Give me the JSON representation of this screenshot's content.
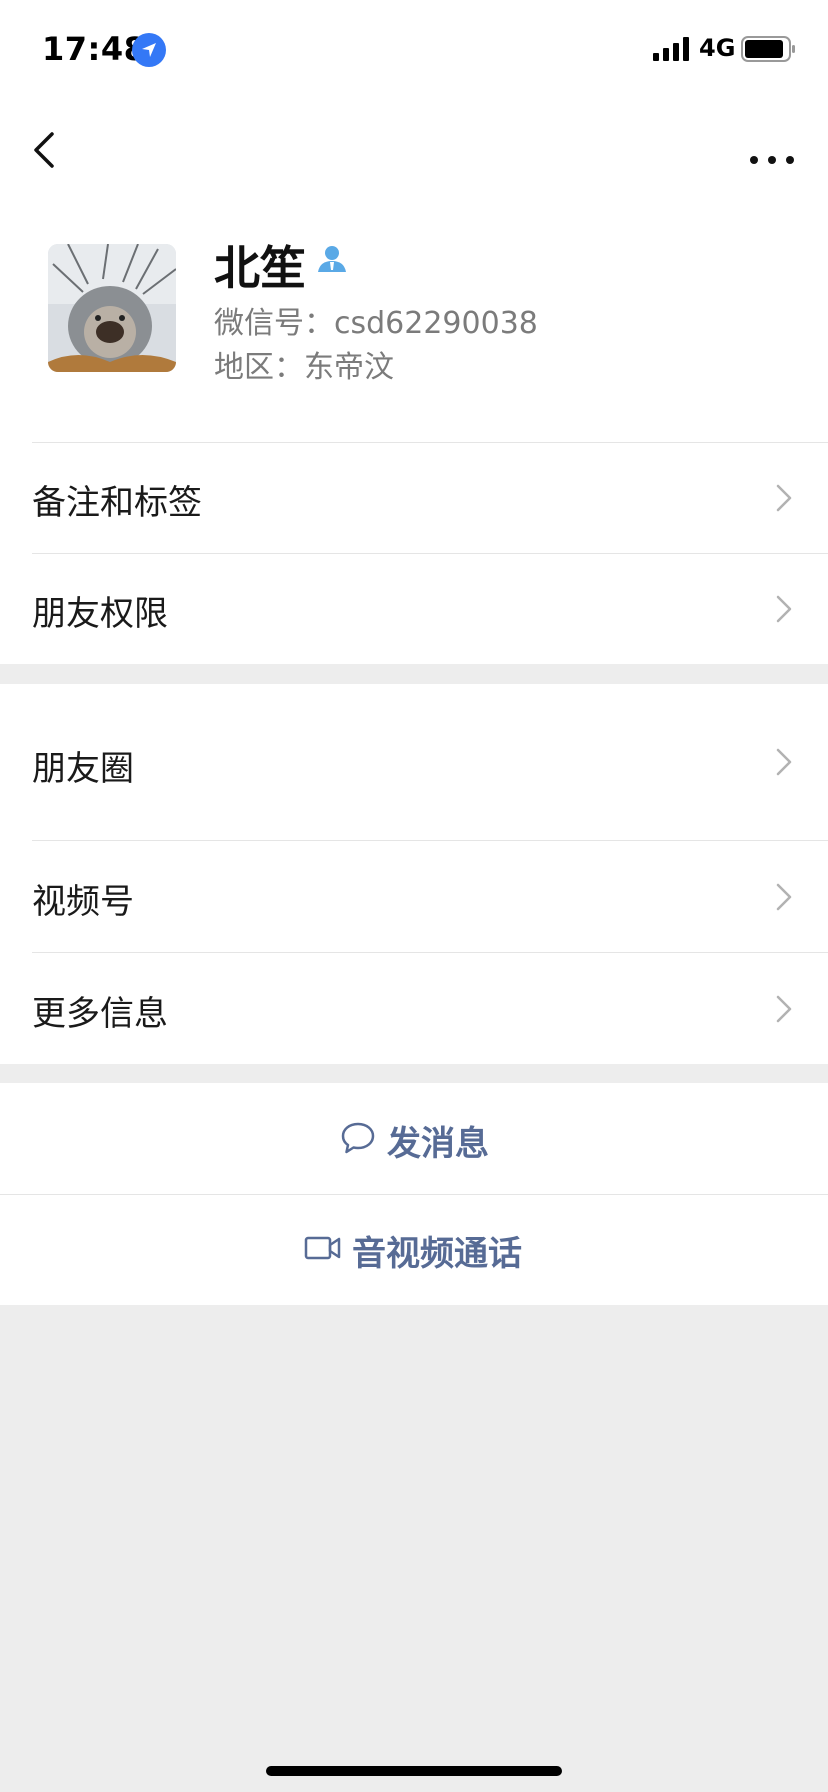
{
  "status_bar": {
    "time": "17:48",
    "network": "4G",
    "icons": [
      "location-arrow-icon",
      "signal-bars-icon",
      "battery-icon"
    ]
  },
  "nav": {
    "back_icon": "chevron-left-icon",
    "more_icon": "ellipsis-icon"
  },
  "profile": {
    "name": "北笙",
    "wechat_id": "微信号：csd62290038",
    "region": "地区：东帝汶",
    "badge_icon": "contact-person-icon"
  },
  "menu_group_1": {
    "items": [
      {
        "label": "备注和标签"
      },
      {
        "label": "朋友权限"
      }
    ]
  },
  "menu_group_2": {
    "items": [
      {
        "label": "朋友圈"
      },
      {
        "label": "视频号"
      },
      {
        "label": "更多信息"
      }
    ]
  },
  "actions": {
    "send_message": "发消息",
    "video_call": "音视频通话"
  },
  "colors": {
    "background": "#ededed",
    "card": "#ffffff",
    "link": "#576b95",
    "accent_blue": "#3478f6",
    "badge_blue": "#5aa9e6"
  }
}
